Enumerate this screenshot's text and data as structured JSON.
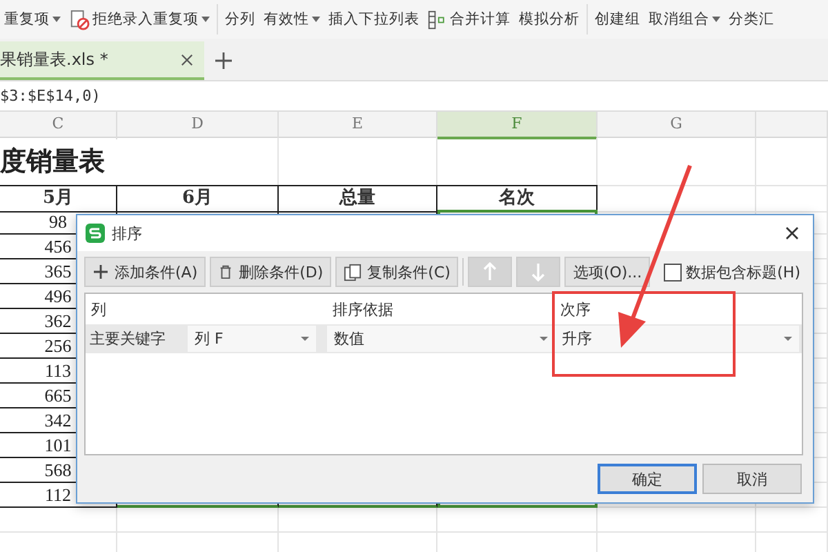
{
  "toolbar": {
    "groups": [
      [
        {
          "label": "重复项",
          "kind": "plain",
          "dropdown": true
        },
        {
          "label": "拒绝录入重复项",
          "kind": "reject",
          "dropdown": true
        }
      ],
      [
        {
          "label": "分列",
          "kind": "plain",
          "dropdown": false
        },
        {
          "label": "有效性",
          "kind": "plain",
          "dropdown": true
        },
        {
          "label": "插入下拉列表",
          "kind": "plain",
          "dropdown": false
        },
        {
          "label": "合并计算",
          "kind": "merge",
          "dropdown": false
        },
        {
          "label": "模拟分析",
          "kind": "plain",
          "dropdown": false
        }
      ],
      [
        {
          "label": "创建组",
          "kind": "plain",
          "dropdown": false
        },
        {
          "label": "取消组合",
          "kind": "plain",
          "dropdown": true
        },
        {
          "label": "分类汇",
          "kind": "plain",
          "dropdown": false
        }
      ]
    ]
  },
  "tabs": [
    {
      "label": "果销量表.xls *",
      "selected": true
    }
  ],
  "formula_bar": {
    "value": "$3:$E$14,0)"
  },
  "sheet": {
    "columns": [
      {
        "letter": "C",
        "selected": false
      },
      {
        "letter": "D",
        "selected": false
      },
      {
        "letter": "E",
        "selected": false
      },
      {
        "letter": "F",
        "selected": true
      },
      {
        "letter": "G",
        "selected": false
      }
    ],
    "title": "度销量表",
    "headers": [
      "5月",
      "6月",
      "总量",
      "名次"
    ],
    "rows": [
      [
        "98"
      ],
      [
        "456"
      ],
      [
        "365"
      ],
      [
        "496"
      ],
      [
        "362"
      ],
      [
        "256"
      ],
      [
        "113"
      ],
      [
        "665"
      ],
      [
        "342"
      ],
      [
        "101"
      ],
      [
        "568"
      ],
      [
        "112"
      ]
    ]
  },
  "dialog": {
    "title": "排序",
    "buttons": [
      {
        "label": "添加条件(A)",
        "kind": "add",
        "disabled": false
      },
      {
        "label": "删除条件(D)",
        "kind": "delete",
        "disabled": false
      },
      {
        "label": "复制条件(C)",
        "kind": "copy",
        "disabled": false
      },
      {
        "kind": "up",
        "disabled": true
      },
      {
        "kind": "down",
        "disabled": true
      },
      {
        "label": "选项(O)...",
        "kind": "plain",
        "disabled": false
      }
    ],
    "header_checkbox": {
      "label": "数据包含标题(H)",
      "checked": false
    },
    "columns": [
      "列",
      "排序依据",
      "次序"
    ],
    "rows": [
      {
        "label": "主要关键字",
        "column": "列 F",
        "basis": "数值",
        "order": "升序"
      }
    ],
    "footer_buttons": [
      {
        "label": "确定",
        "default": true
      },
      {
        "label": "取消",
        "default": false
      }
    ]
  }
}
